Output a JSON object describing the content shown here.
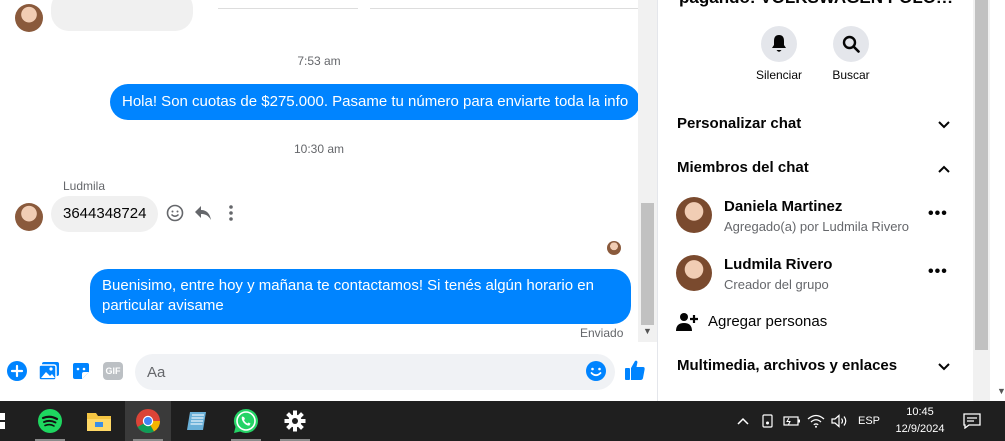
{
  "chat": {
    "messages": {
      "time_1": "7:53 am",
      "out_1": "Hola! Son cuotas de $275.000. Pasame tu número para enviarte toda la info",
      "time_2": "10:30 am",
      "sender": "Ludmila",
      "in_1": "3644348724",
      "out_2": "Buenisimo, entre hoy y mañana te contactamos! Si tenés algún horario en particular avisame",
      "status": "Enviado"
    },
    "composer": {
      "placeholder": "Aa",
      "gif_label": "GIF"
    }
  },
  "info": {
    "title": "pagando! VOLKSWAGEN POLO!!!",
    "actions": [
      {
        "label": "Silenciar",
        "icon": "bell-icon"
      },
      {
        "label": "Buscar",
        "icon": "search-icon"
      }
    ],
    "sections": {
      "customize": "Personalizar chat",
      "members": "Miembros del chat",
      "media": "Multimedia, archivos y enlaces"
    },
    "members": [
      {
        "name": "Daniela Martinez",
        "sub": "Agregado(a) por Ludmila Rivero"
      },
      {
        "name": "Ludmila Rivero",
        "sub": "Creador del grupo"
      }
    ],
    "add_people": "Agregar personas"
  },
  "taskbar": {
    "apps": [
      "spotify-icon",
      "file-explorer-icon",
      "chrome-icon",
      "notepad-icon",
      "whatsapp-icon",
      "settings-icon"
    ],
    "language": "ESP",
    "time": "10:45",
    "date": "12/9/2024"
  },
  "colors": {
    "accent": "#0084ff",
    "taskbar": "#1f1f1f"
  }
}
